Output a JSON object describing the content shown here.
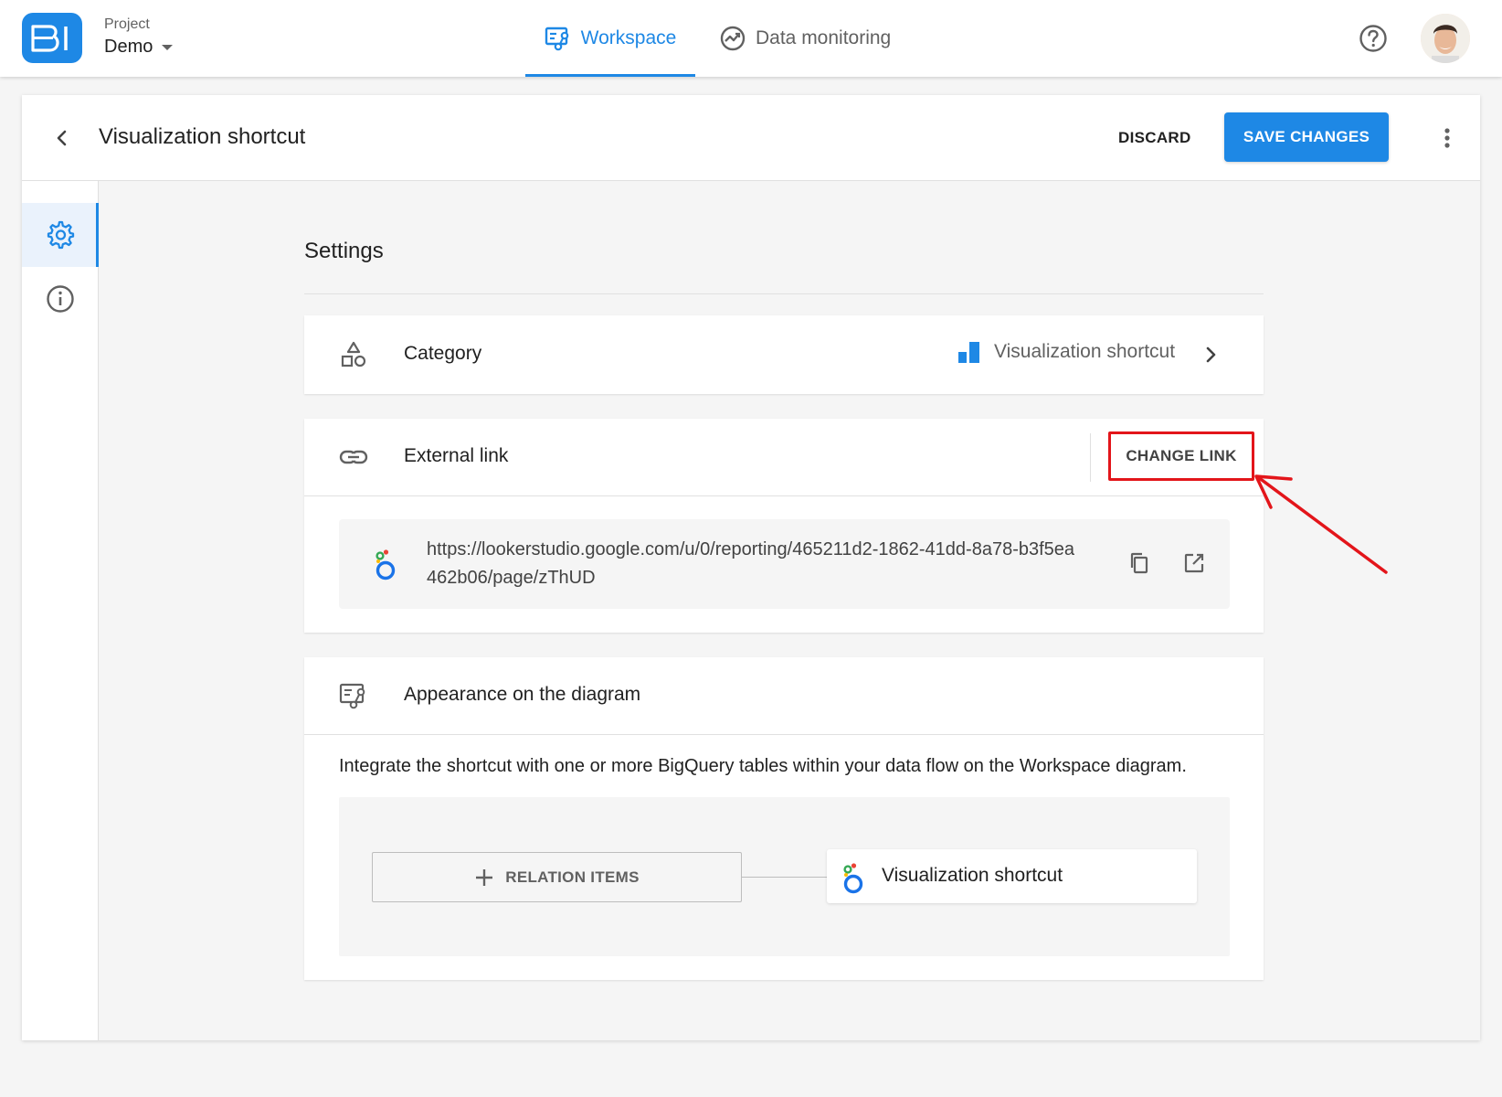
{
  "header": {
    "logo_text": "BI",
    "project_label": "Project",
    "project_name": "Demo",
    "tabs": [
      {
        "label": "Workspace",
        "active": true,
        "icon": "workspace-icon"
      },
      {
        "label": "Data monitoring",
        "active": false,
        "icon": "monitoring-icon"
      }
    ],
    "help_icon": "help-icon",
    "avatar": "user-avatar"
  },
  "page": {
    "title": "Visualization shortcut",
    "discard_label": "DISCARD",
    "save_label": "SAVE CHANGES"
  },
  "side_rail": {
    "items": [
      {
        "icon": "gear-icon",
        "active": true
      },
      {
        "icon": "info-icon",
        "active": false
      }
    ]
  },
  "settings": {
    "heading": "Settings",
    "category": {
      "label": "Category",
      "value": "Visualization shortcut"
    },
    "external_link": {
      "label": "External link",
      "change_label": "CHANGE LINK",
      "url": "https://lookerstudio.google.com/u/0/reporting/465211d2-1862-41dd-8a78-b3f5ea462b06/page/zThUD"
    },
    "appearance": {
      "label": "Appearance on the diagram",
      "description": "Integrate the shortcut with one or more BigQuery tables within your data flow on the Workspace diagram.",
      "relation_label": "RELATION ITEMS",
      "node_label": "Visualization shortcut"
    }
  },
  "colors": {
    "primary": "#1e88e5",
    "highlight": "#e3151a",
    "background": "#f5f5f5"
  }
}
